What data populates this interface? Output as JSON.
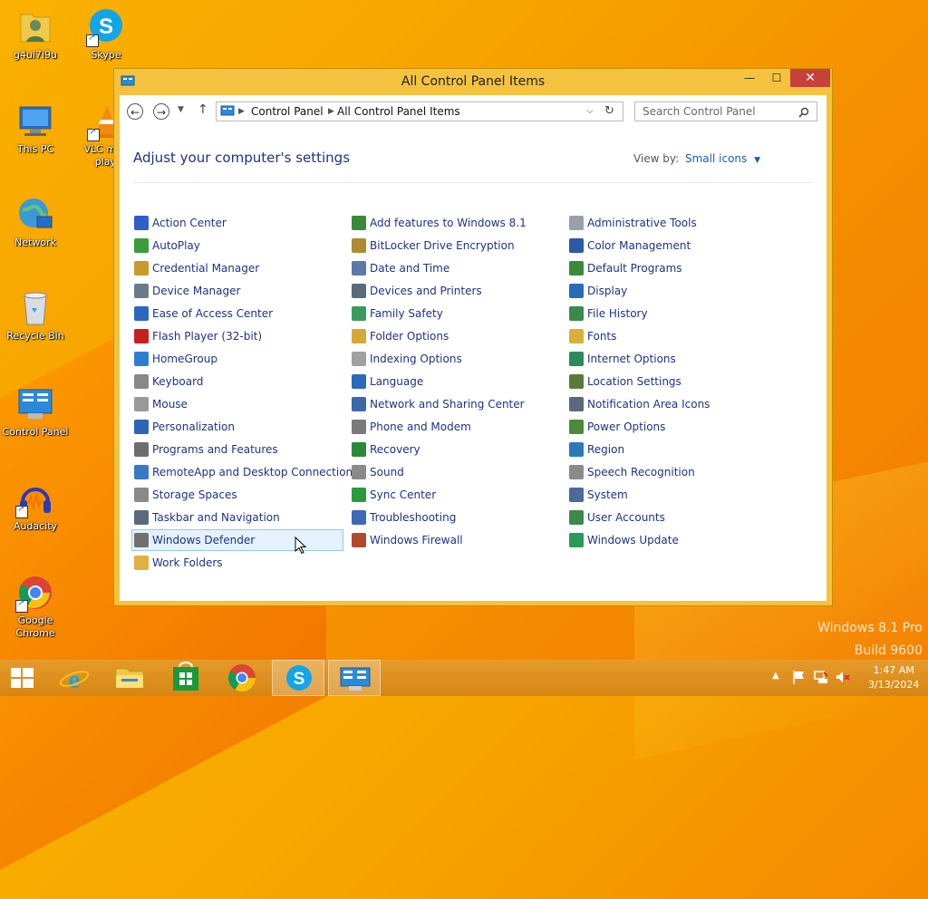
{
  "desktop": {
    "icons": [
      {
        "label": "g4ui7i9u"
      },
      {
        "label": "Skype"
      },
      {
        "label": "This PC"
      },
      {
        "label": "VLC m play"
      },
      {
        "label": "Network"
      },
      {
        "label": "Recycle Bin"
      },
      {
        "label": "Control Panel"
      },
      {
        "label": "Audacity"
      },
      {
        "label": "Google Chrome"
      }
    ],
    "watermark": {
      "line1": "Windows 8.1 Pro",
      "line2": "Build 9600"
    }
  },
  "window": {
    "title": "All Control Panel Items",
    "controls": {
      "minimize": "—",
      "maximize": "☐",
      "close": "✕"
    },
    "nav": {
      "back": "←",
      "forward": "→",
      "up": "↑",
      "breadcrumb": [
        "Control Panel",
        "All Control Panel Items"
      ],
      "search_placeholder": "Search Control Panel"
    },
    "heading": "Adjust your computer's settings",
    "view_by_label": "View by:",
    "view_by_value": "Small icons",
    "columns": [
      [
        {
          "label": "Action Center",
          "icon": "flag-icon",
          "color": "#2d5ec9"
        },
        {
          "label": "AutoPlay",
          "icon": "autoplay-icon",
          "color": "#3a9c3a"
        },
        {
          "label": "Credential Manager",
          "icon": "vault-icon",
          "color": "#c89b2a"
        },
        {
          "label": "Device Manager",
          "icon": "printer-icon",
          "color": "#6b7b8c"
        },
        {
          "label": "Ease of Access Center",
          "icon": "accessibility-icon",
          "color": "#2a67c0"
        },
        {
          "label": "Flash Player (32-bit)",
          "icon": "flash-icon",
          "color": "#c62020"
        },
        {
          "label": "HomeGroup",
          "icon": "homegroup-icon",
          "color": "#2b7fd1"
        },
        {
          "label": "Keyboard",
          "icon": "keyboard-icon",
          "color": "#888888"
        },
        {
          "label": "Mouse",
          "icon": "mouse-icon",
          "color": "#9a9a9a"
        },
        {
          "label": "Personalization",
          "icon": "personalization-icon",
          "color": "#2e64b8"
        },
        {
          "label": "Programs and Features",
          "icon": "programs-icon",
          "color": "#6d6d6d"
        },
        {
          "label": "RemoteApp and Desktop Connections",
          "icon": "remoteapp-icon",
          "color": "#3a78c8"
        },
        {
          "label": "Storage Spaces",
          "icon": "storage-icon",
          "color": "#8a8a8a"
        },
        {
          "label": "Taskbar and Navigation",
          "icon": "taskbar-icon",
          "color": "#5a6a7a"
        },
        {
          "label": "Windows Defender",
          "icon": "defender-icon",
          "color": "#707070"
        },
        {
          "label": "Work Folders",
          "icon": "folder-icon",
          "color": "#e0b040"
        }
      ],
      [
        {
          "label": "Add features to Windows 8.1",
          "icon": "add-features-icon",
          "color": "#3a8a3a"
        },
        {
          "label": "BitLocker Drive Encryption",
          "icon": "bitlocker-icon",
          "color": "#b08a30"
        },
        {
          "label": "Date and Time",
          "icon": "clock-icon",
          "color": "#5a7aa8"
        },
        {
          "label": "Devices and Printers",
          "icon": "devices-icon",
          "color": "#5a6a7a"
        },
        {
          "label": "Family Safety",
          "icon": "family-icon",
          "color": "#3a9a5a"
        },
        {
          "label": "Folder Options",
          "icon": "folder-options-icon",
          "color": "#d8a838"
        },
        {
          "label": "Indexing Options",
          "icon": "indexing-icon",
          "color": "#a0a0a0"
        },
        {
          "label": "Language",
          "icon": "language-icon",
          "color": "#2a6ab8"
        },
        {
          "label": "Network and Sharing Center",
          "icon": "network-icon",
          "color": "#3a6aa8"
        },
        {
          "label": "Phone and Modem",
          "icon": "phone-icon",
          "color": "#7a7a7a"
        },
        {
          "label": "Recovery",
          "icon": "recovery-icon",
          "color": "#2a8a3a"
        },
        {
          "label": "Sound",
          "icon": "speaker-icon",
          "color": "#8a8a8a"
        },
        {
          "label": "Sync Center",
          "icon": "sync-icon",
          "color": "#2a9a3a"
        },
        {
          "label": "Troubleshooting",
          "icon": "troubleshoot-icon",
          "color": "#3a6ab8"
        },
        {
          "label": "Windows Firewall",
          "icon": "firewall-icon",
          "color": "#b04a2a"
        }
      ],
      [
        {
          "label": "Administrative Tools",
          "icon": "admin-tools-icon",
          "color": "#9aa0a8"
        },
        {
          "label": "Color Management",
          "icon": "color-icon",
          "color": "#2a5aa8"
        },
        {
          "label": "Default Programs",
          "icon": "default-programs-icon",
          "color": "#3a8a3a"
        },
        {
          "label": "Display",
          "icon": "display-icon",
          "color": "#2a6ab8"
        },
        {
          "label": "File History",
          "icon": "file-history-icon",
          "color": "#3a8a4a"
        },
        {
          "label": "Fonts",
          "icon": "fonts-icon",
          "color": "#d8b038"
        },
        {
          "label": "Internet Options",
          "icon": "internet-icon",
          "color": "#2a8a5a"
        },
        {
          "label": "Location Settings",
          "icon": "location-icon",
          "color": "#5a7a3a"
        },
        {
          "label": "Notification Area Icons",
          "icon": "notification-icon",
          "color": "#5a6a7a"
        },
        {
          "label": "Power Options",
          "icon": "power-icon",
          "color": "#4a8a3a"
        },
        {
          "label": "Region",
          "icon": "region-icon",
          "color": "#2a7ab8"
        },
        {
          "label": "Speech Recognition",
          "icon": "microphone-icon",
          "color": "#8a8a8a"
        },
        {
          "label": "System",
          "icon": "system-icon",
          "color": "#4a6a9a"
        },
        {
          "label": "User Accounts",
          "icon": "users-icon",
          "color": "#3a8a4a"
        },
        {
          "label": "Windows Update",
          "icon": "update-icon",
          "color": "#2a9a5a"
        }
      ]
    ]
  },
  "taskbar": {
    "time": "1:47 AM",
    "date": "3/13/2024"
  }
}
